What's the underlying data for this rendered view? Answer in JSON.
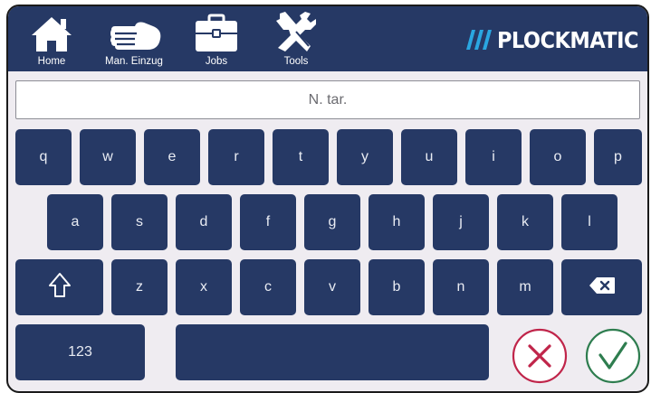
{
  "nav": {
    "items": [
      {
        "label": "Home",
        "icon": "home-icon"
      },
      {
        "label": "Man. Einzug",
        "icon": "hand-icon"
      },
      {
        "label": "Jobs",
        "icon": "briefcase-icon"
      },
      {
        "label": "Tools",
        "icon": "tools-icon"
      }
    ],
    "brand": "PLOCKMATIC"
  },
  "input": {
    "placeholder": "N. tar.",
    "value": ""
  },
  "keyboard": {
    "row1": [
      "q",
      "w",
      "e",
      "r",
      "t",
      "y",
      "u",
      "i",
      "o",
      "p"
    ],
    "row2": [
      "a",
      "s",
      "d",
      "f",
      "g",
      "h",
      "j",
      "k",
      "l"
    ],
    "row3": [
      "z",
      "x",
      "c",
      "v",
      "b",
      "n",
      "m"
    ],
    "shift_icon": "shift-icon",
    "backspace_icon": "backspace-icon",
    "numbers_label": "123",
    "space_label": ""
  },
  "actions": {
    "cancel_icon": "cancel-icon",
    "confirm_icon": "confirm-icon"
  },
  "colors": {
    "navy": "#263965",
    "background": "#efecf1",
    "cancel": "#c0254a",
    "confirm": "#2e7d4f"
  }
}
